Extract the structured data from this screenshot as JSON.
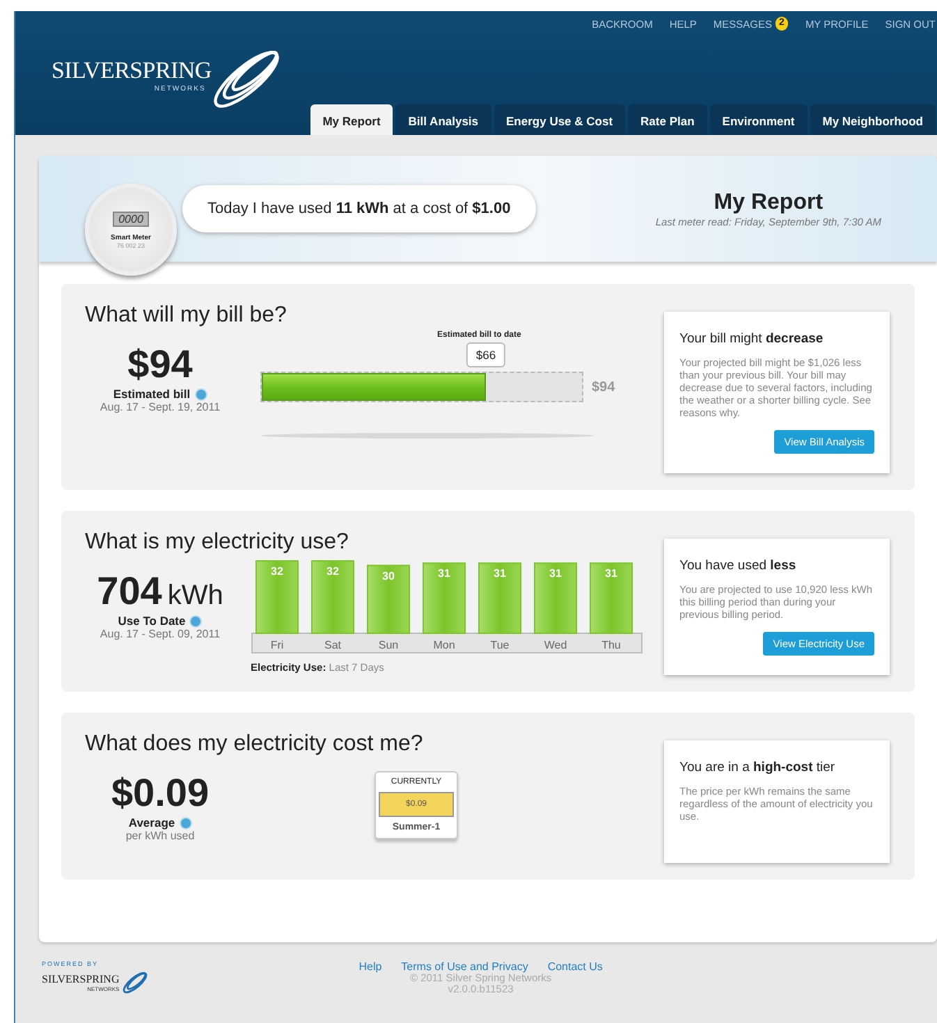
{
  "header": {
    "logo": {
      "name": "SILVERSPRING",
      "sub": "NETWORKS"
    },
    "nav": [
      {
        "label": "BACKROOM"
      },
      {
        "label": "HELP"
      },
      {
        "label": "MESSAGES",
        "badge": "2"
      },
      {
        "label": "MY PROFILE"
      },
      {
        "label": "SIGN OUT"
      }
    ],
    "tabs": [
      {
        "label": "My Report",
        "selected": true
      },
      {
        "label": "Bill Analysis",
        "selected": false
      },
      {
        "label": "Energy Use & Cost",
        "selected": false
      },
      {
        "label": "Rate Plan",
        "selected": false
      },
      {
        "label": "Environment",
        "selected": false
      },
      {
        "label": "My Neighborhood",
        "selected": false
      }
    ]
  },
  "banner": {
    "meter": {
      "display": "0000",
      "label": "Smart Meter",
      "serial": "76 002 23"
    },
    "message": "Today I have used **11 kWh** at a cost of **$1.00**",
    "title": "My Report",
    "subtitle": "Last meter read: Friday, September 9th, 7:30 AM"
  },
  "sections": [
    {
      "kind": "bill",
      "title": "What will my bill be?",
      "value": "$94",
      "label": "Estimated bill",
      "dates": "Aug. 17 - Sept. 19, 2011",
      "progress": {
        "caption": "Estimated bill to date",
        "marker": "$66",
        "level": 0.7,
        "total": "$94"
      },
      "callout": {
        "heading": "Your bill might **decrease**",
        "body": "Your projected bill might be $1,026 less than your previous bill. Your bill may decrease due to several factors, including the weather or a shorter billing cycle. See reasons why.",
        "button": "View Bill Analysis"
      }
    },
    {
      "kind": "use",
      "title": "What is my electricity use?",
      "value": "704",
      "unit": "kWh",
      "label": "Use To Date",
      "dates": "Aug. 17 - Sept. 09, 2011",
      "chart_data": {
        "type": "bar",
        "categories": [
          "Fri",
          "Sat",
          "Sun",
          "Mon",
          "Tue",
          "Wed",
          "Thu"
        ],
        "series": [
          {
            "name": "Electricity Use:",
            "color": "#7cc52a",
            "values": [
              32,
              32,
              30,
              31,
              31,
              31,
              31
            ]
          }
        ],
        "data_labels": true
      },
      "caption": "Last 7 Days",
      "callout": {
        "heading": "You have used **less**",
        "body": "You are projected to use 10,920 less kWh this billing period than during your previous billing period.",
        "button": "View Electricity Use"
      }
    },
    {
      "kind": "cost",
      "title": "What does my electricity cost me?",
      "value": "$0.09",
      "label": "Average",
      "dates": "per kWh used",
      "tier": {
        "header": "CURRENTLY",
        "price": "$0.09",
        "name": "Summer-1"
      },
      "callout": {
        "heading": "You are in a **high-cost** tier",
        "body": "The price per kWh remains the same regardless of the amount of electricity you use."
      }
    }
  ],
  "footer": {
    "logo": {
      "powered": "POWERED BY",
      "name": "SILVERSPRING",
      "sub": "NETWORKS"
    },
    "links": [
      "Help",
      "Terms of Use and Privacy",
      "Contact Us"
    ],
    "copyright": "© 2011 Silver Spring Networks",
    "version": "v2.0.0.b11523"
  }
}
